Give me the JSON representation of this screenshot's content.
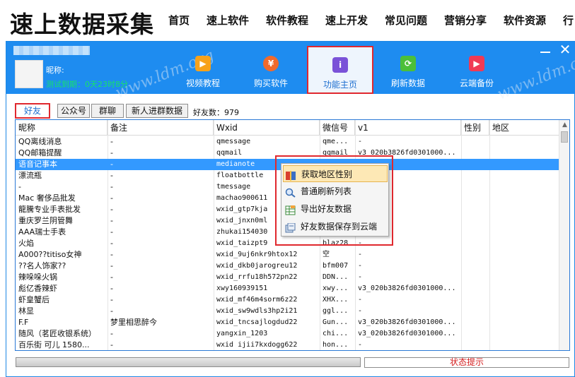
{
  "site": {
    "brand": "速上数据采集",
    "nav": [
      "首页",
      "速上软件",
      "软件教程",
      "速上开发",
      "常见问题",
      "营销分享",
      "软件资源",
      "行"
    ]
  },
  "app": {
    "nickname_label": "昵称:",
    "trial_text": "测试到期：0天23时8分",
    "toolbar": [
      {
        "label": "视频教程",
        "icon": "video-icon",
        "color": "#f7a21b"
      },
      {
        "label": "购买软件",
        "icon": "cart-icon",
        "color": "#f16a2c"
      },
      {
        "label": "功能主页",
        "icon": "home-icon",
        "color": "#7a52d8",
        "active": true
      },
      {
        "label": "刷新数据",
        "icon": "refresh-icon",
        "color": "#4cbf39"
      },
      {
        "label": "云端备份",
        "icon": "cloud-backup-icon",
        "color": "#f03a55"
      }
    ],
    "watermark": "www.ldm.org"
  },
  "tabs": [
    {
      "label": "好友",
      "active": true
    },
    {
      "label": "公众号"
    },
    {
      "label": "群聊"
    },
    {
      "label": "新人进群数据"
    }
  ],
  "friend_count": "好友数：979",
  "grid": {
    "columns": [
      "昵称",
      "备注",
      "Wxid",
      "微信号",
      "v1",
      "性别",
      "地区"
    ],
    "rows": [
      [
        "QQ离线消息",
        "-",
        "qmessage",
        "qme...",
        "-",
        "",
        ""
      ],
      [
        "QQ邮箱提醒",
        "-",
        "qqmail",
        "qqmail",
        "v3_020b3826fd0301000...",
        "",
        ""
      ],
      [
        "语音记事本",
        "-",
        "medianote",
        "",
        "",
        "",
        ""
      ],
      [
        "漂流瓶",
        "-",
        "floatbottle",
        "",
        "",
        "",
        ""
      ],
      [
        "-",
        "-",
        "tmessage",
        "",
        "",
        "",
        ""
      ],
      [
        "Mac 奢侈品批发",
        "-",
        "machao900611",
        "",
        "",
        "",
        ""
      ],
      [
        "龍騰专业手表批发",
        "-",
        "wxid_gtp7kja",
        "",
        "",
        "",
        ""
      ],
      [
        "重庆罗兰阴管舞",
        "-",
        "wxid_jnxn0ml",
        "",
        "",
        "",
        ""
      ],
      [
        "AAA瑞士手表",
        "-",
        "zhukai154030",
        "",
        "",
        "",
        ""
      ],
      [
        "火焰",
        "-",
        "wxid_taizpt9",
        "blaz28",
        "-",
        "",
        ""
      ],
      [
        "A000??titiso女神",
        "-",
        "wxid_9uj6nkr9htox12",
        "空",
        "-",
        "",
        ""
      ],
      [
        "??名人饰家??",
        "-",
        "wxid_dkb0jarogreu12",
        "bfm007",
        "-",
        "",
        ""
      ],
      [
        "辣哚哚火锅",
        "-",
        "wxid_rrfu18h572pn22",
        "DDN...",
        "-",
        "",
        ""
      ],
      [
        "彪亿香辣虾",
        "-",
        "xwy160939151",
        "xwy...",
        "v3_020b3826fd0301000...",
        "",
        ""
      ],
      [
        "虾皇蟹后",
        "-",
        "wxid_mf46m4sorm6z22",
        "XHX...",
        "-",
        "",
        ""
      ],
      [
        "林显",
        "-",
        "wxid_sw9wdls3hp2i21",
        "ggl...",
        "-",
        "",
        ""
      ],
      [
        "F.F",
        "梦里相思醉今",
        "wxid_tncsajlogdud22",
        "Gun...",
        "v3_020b3826fd0301000...",
        "",
        ""
      ],
      [
        "随风（茗匠收银系统）",
        "-",
        "yangxin_1203",
        "chi...",
        "v3_020b3826fd0301000...",
        "",
        ""
      ],
      [
        "百乐街  可儿 1580...",
        "-",
        "wxid ijii7kxdogg622",
        "hon...",
        "-",
        "",
        ""
      ]
    ],
    "selected_row": 2
  },
  "context_menu": [
    {
      "label": "获取地区性别",
      "icon": "book-icon",
      "hover": true
    },
    {
      "label": "普通刷新列表",
      "icon": "magnifier-icon"
    },
    {
      "label": "导出好友数据",
      "icon": "spreadsheet-icon"
    },
    {
      "label": "好友数据保存到云端",
      "icon": "cloud-save-icon"
    }
  ],
  "status_text": "状态提示"
}
